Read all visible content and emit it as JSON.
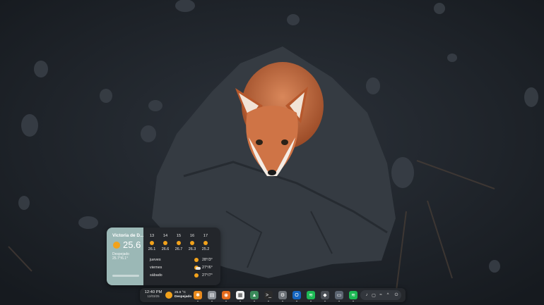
{
  "wallpaper": {
    "description_icon": "fox-on-rock-wallpaper"
  },
  "weather_widget": {
    "city": "Victoria de D...",
    "current_temp": "25.6",
    "condition": "Despejado",
    "range": "25.7°/6.1°",
    "hourly": [
      {
        "hour": "13",
        "temp": "26.1"
      },
      {
        "hour": "14",
        "temp": "26.6"
      },
      {
        "hour": "15",
        "temp": "26.7"
      },
      {
        "hour": "16",
        "temp": "26.3"
      },
      {
        "hour": "17",
        "temp": "25.2"
      }
    ],
    "daily": [
      {
        "day": "jueves",
        "icon": "sun-icon",
        "range": "28°/3°"
      },
      {
        "day": "viernes",
        "icon": "partly-cloudy-icon",
        "range": "27°/6°"
      },
      {
        "day": "sábado",
        "icon": "sun-icon",
        "range": "27°/7°"
      }
    ],
    "colors": {
      "panel": "#9bb8b6",
      "sun": "#f2a21b"
    }
  },
  "taskbar": {
    "time": "12:40 PM",
    "date": "12/03/25",
    "weather_temp": "25.6 °C",
    "weather_condition": "Despejado",
    "apps": [
      {
        "name": "pinwheel-app-icon",
        "color": "#e8891c",
        "glyph": "✱"
      },
      {
        "name": "file-manager-icon",
        "color": "#8a8f96",
        "glyph": "▤"
      },
      {
        "name": "firefox-icon",
        "color": "#e46a1b",
        "glyph": "◉"
      },
      {
        "name": "calendar-icon",
        "color": "#f0f0f0",
        "glyph": "▦"
      },
      {
        "name": "image-viewer-icon",
        "color": "#3a8a5a",
        "glyph": "▲"
      },
      {
        "name": "terminal-icon",
        "color": "#2b2b2b",
        "glyph": ">_"
      },
      {
        "name": "settings-icon",
        "color": "#6d7278",
        "glyph": "⚙"
      },
      {
        "name": "outlook-icon",
        "color": "#1565c0",
        "glyph": "O"
      },
      {
        "name": "spotify-icon",
        "color": "#1db954",
        "glyph": "≋"
      },
      {
        "name": "git-app-icon",
        "color": "#4a4e55",
        "glyph": "◆"
      },
      {
        "name": "display-app-icon",
        "color": "#5b6470",
        "glyph": "▭"
      },
      {
        "name": "spotify-icon-2",
        "color": "#1db954",
        "glyph": "≋"
      }
    ],
    "tray": [
      {
        "name": "volume-icon",
        "glyph": "♪"
      },
      {
        "name": "clipboard-icon",
        "glyph": "▢"
      },
      {
        "name": "wifi-icon",
        "glyph": "≈"
      },
      {
        "name": "chevron-up-icon",
        "glyph": "^"
      },
      {
        "name": "power-icon",
        "glyph": "⏻"
      }
    ]
  }
}
